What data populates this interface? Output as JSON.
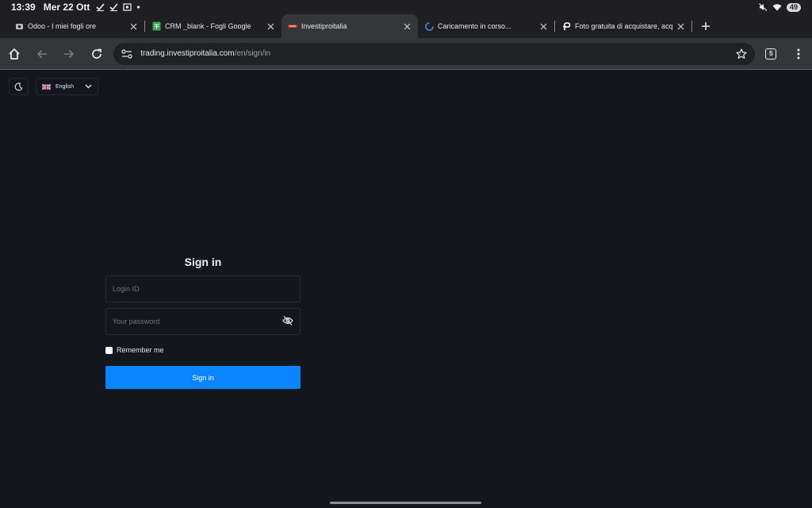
{
  "status_bar": {
    "time": "13:39",
    "date": "Mer 22 Ott",
    "battery": "49"
  },
  "tabs": [
    {
      "title": "Odoo - I miei fogli ore",
      "icon": "odoo-icon",
      "active": false
    },
    {
      "title": "CRM _blank - Fogli Google",
      "icon": "sheets-icon",
      "active": false
    },
    {
      "title": "Investiproitalia",
      "icon": "site-favicon",
      "active": true
    },
    {
      "title": "Caricamento in corso...",
      "icon": "loading-spinner-icon",
      "active": false
    },
    {
      "title": "Foto gratuita di acquistare, acquisti",
      "icon": "freepik-icon",
      "active": false
    }
  ],
  "toolbar": {
    "url_host": "trading.investiproitalia.com",
    "url_path": "/en/sign/in",
    "tab_count": "5"
  },
  "page": {
    "language": "English",
    "title": "Sign in",
    "login_placeholder": "Login ID",
    "password_placeholder": "Your password",
    "remember_label": "Remember me",
    "submit_label": "Sign in"
  },
  "colors": {
    "background": "#14161e",
    "accent": "#0a84ff",
    "toolbar": "#35363a"
  }
}
